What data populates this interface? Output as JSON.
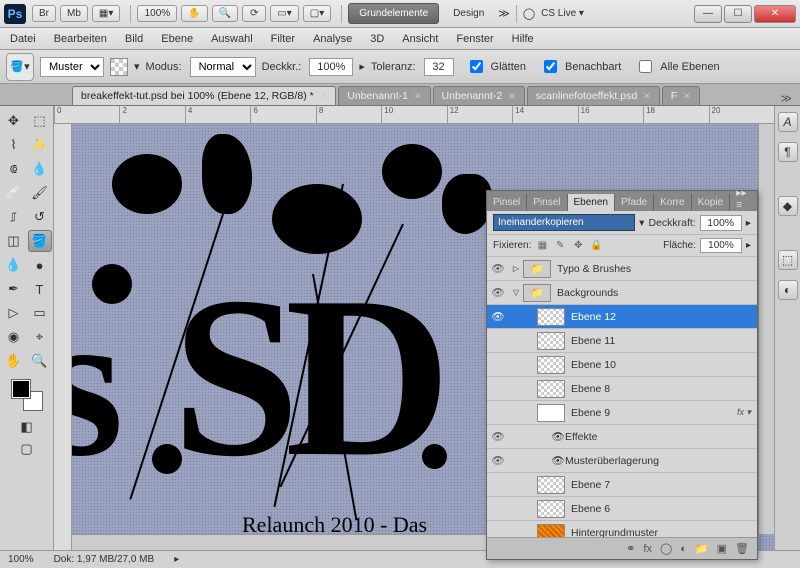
{
  "titlebar": {
    "ps": "Ps",
    "br": "Br",
    "mb": "Mb",
    "zoom": "100%",
    "ws_active": "Grundelemente",
    "ws_design": "Design",
    "cslive": "CS Live"
  },
  "menu": [
    "Datei",
    "Bearbeiten",
    "Bild",
    "Ebene",
    "Auswahl",
    "Filter",
    "Analyse",
    "3D",
    "Ansicht",
    "Fenster",
    "Hilfe"
  ],
  "options": {
    "pattern_label": "Muster",
    "mode_label": "Modus:",
    "mode_value": "Normal",
    "opacity_label": "Deckkr.:",
    "opacity_value": "100%",
    "tolerance_label": "Toleranz:",
    "tolerance_value": "32",
    "antialias": "Glätten",
    "contiguous": "Benachbart",
    "all_layers": "Alle Ebenen"
  },
  "tabs": [
    {
      "label": "breakeffekt-tut.psd bei 100% (Ebene 12, RGB/8) *",
      "active": true
    },
    {
      "label": "Unbenannt-1",
      "active": false
    },
    {
      "label": "Unbenannt-2",
      "active": false
    },
    {
      "label": "scanlinefotoeffekt.psd",
      "active": false
    },
    {
      "label": "F",
      "active": false
    }
  ],
  "ruler_ticks": [
    "0",
    "2",
    "4",
    "6",
    "8",
    "10",
    "12",
    "14",
    "16",
    "18",
    "20"
  ],
  "canvas": {
    "big_text_1": "SD",
    "big_text_prefix": "s",
    "caption": "Relaunch 2010 - Das"
  },
  "panel": {
    "tabs": [
      "Pinsel",
      "Pinsel",
      "Ebenen",
      "Pfade",
      "Korre",
      "Kopie"
    ],
    "active_tab": 2,
    "mode": "Ineinanderkopieren",
    "opacity_label": "Deckkraft:",
    "opacity_value": "100%",
    "lock_label": "Fixieren:",
    "fill_label": "Fläche:",
    "fill_value": "100%",
    "layers": [
      {
        "vis": true,
        "type": "group",
        "name": "Typo & Brushes",
        "indent": 0,
        "open": false
      },
      {
        "vis": true,
        "type": "group",
        "name": "Backgrounds",
        "indent": 0,
        "open": true
      },
      {
        "vis": true,
        "type": "layer",
        "name": "Ebene 12",
        "indent": 2,
        "selected": true
      },
      {
        "vis": false,
        "type": "layer",
        "name": "Ebene 11",
        "indent": 2
      },
      {
        "vis": false,
        "type": "layer",
        "name": "Ebene 10",
        "indent": 2
      },
      {
        "vis": false,
        "type": "layer",
        "name": "Ebene 8",
        "indent": 2
      },
      {
        "vis": false,
        "type": "layer",
        "name": "Ebene 9",
        "indent": 2,
        "solid": true,
        "fx": true
      },
      {
        "vis": true,
        "type": "fx-line",
        "name": "Effekte",
        "indent": 3
      },
      {
        "vis": true,
        "type": "fx-line",
        "name": "Musterüberlagerung",
        "indent": 3
      },
      {
        "vis": false,
        "type": "layer",
        "name": "Ebene 7",
        "indent": 2
      },
      {
        "vis": false,
        "type": "layer",
        "name": "Ebene 6",
        "indent": 2
      },
      {
        "vis": false,
        "type": "layer",
        "name": "Hintergrundmuster",
        "indent": 2,
        "pattern": true
      }
    ]
  },
  "status": {
    "zoom": "100%",
    "doc": "Dok: 1,97 MB/27,0 MB"
  }
}
